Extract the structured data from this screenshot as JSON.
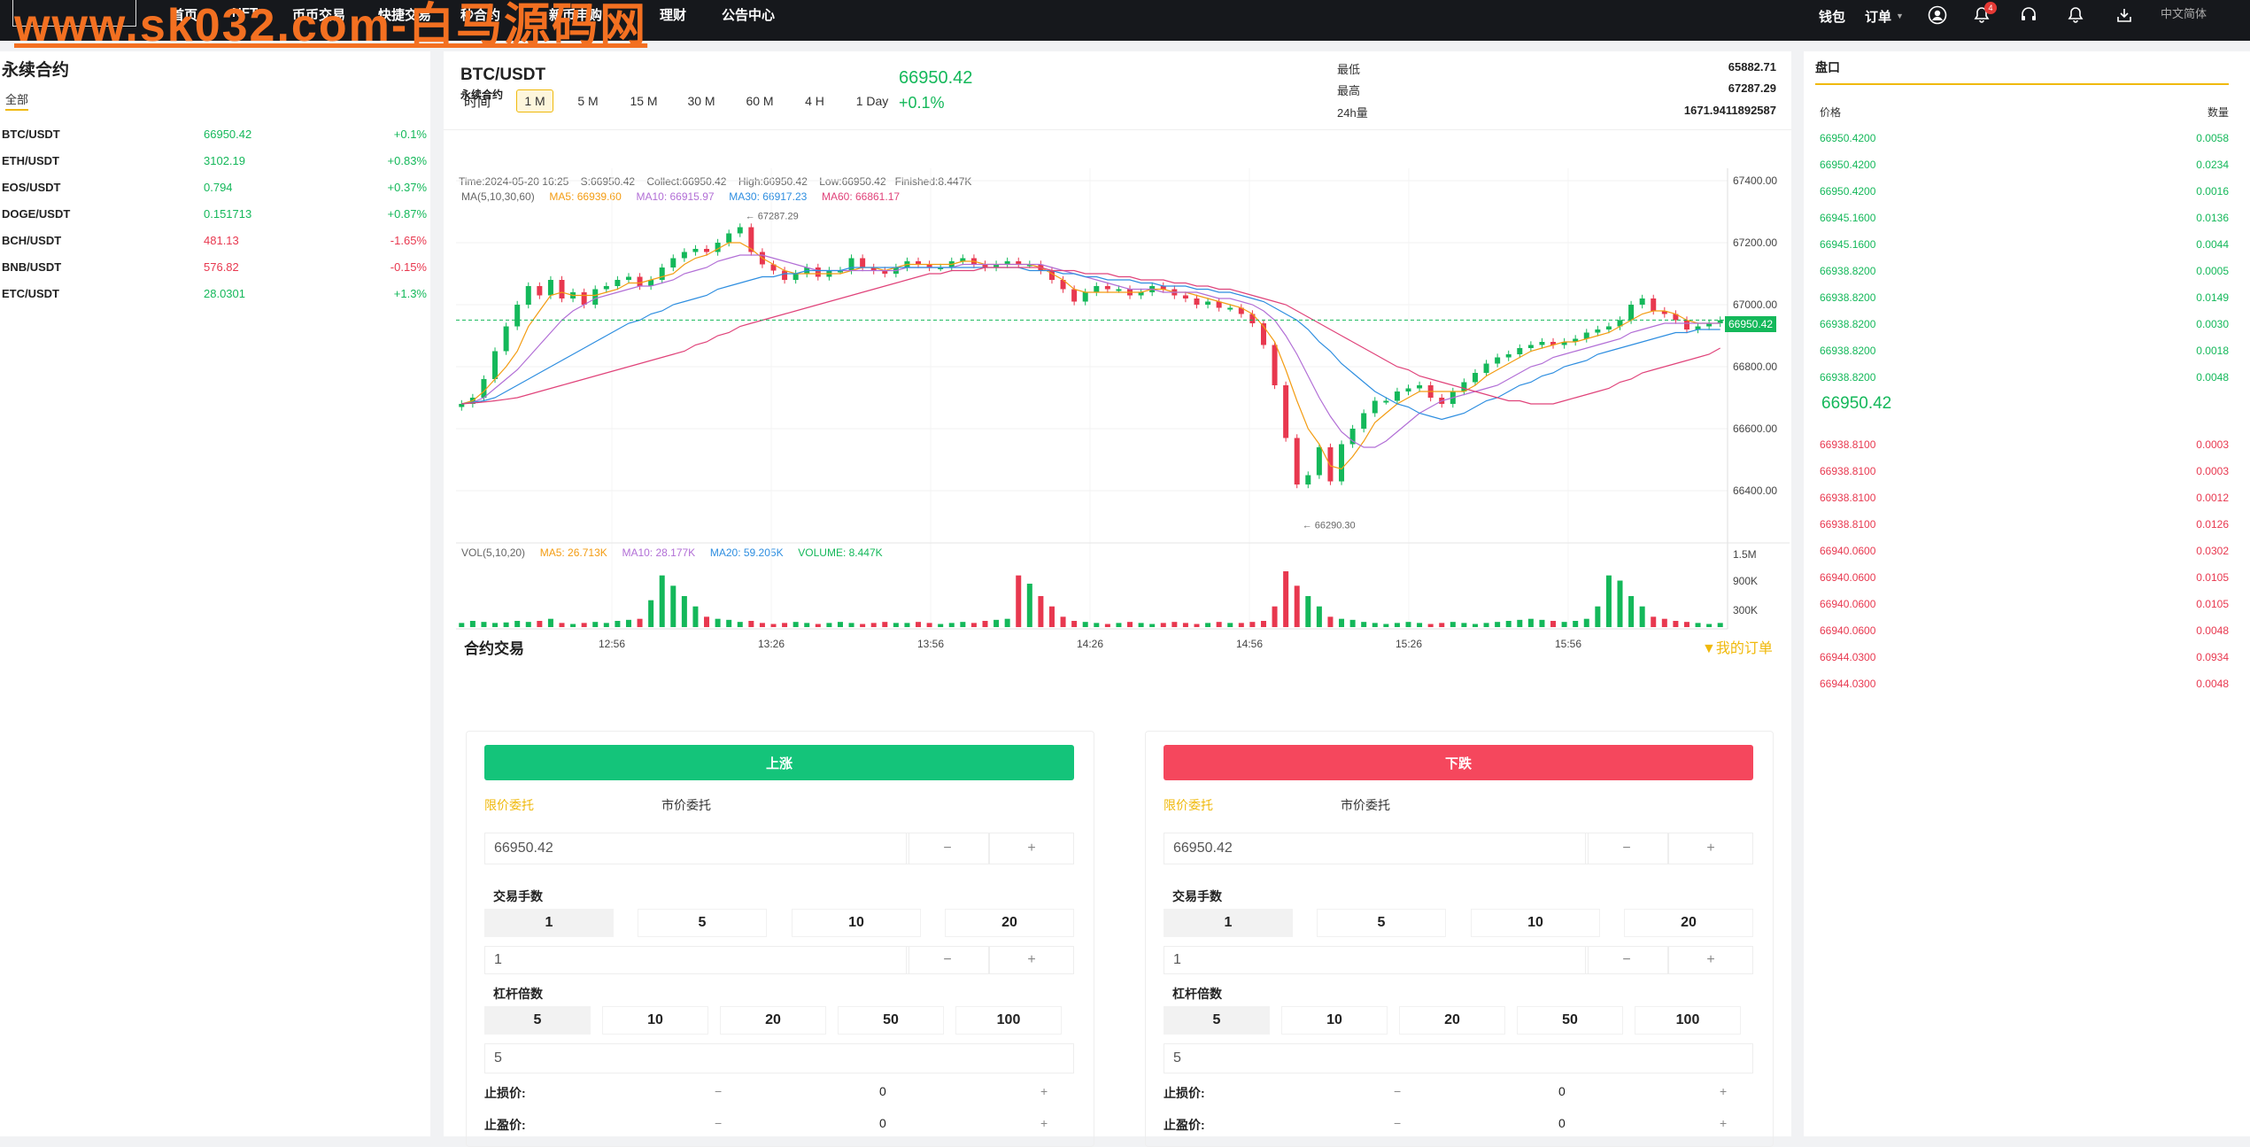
{
  "watermark": "www.sk032.com-白马源码网",
  "nav": [
    "首页",
    "NFT",
    "币币交易",
    "快捷交易",
    "秒合约",
    "新币申购",
    "理财",
    "公告中心"
  ],
  "top_right": {
    "wallet": "钱包",
    "orders": "订单",
    "notif_count": "4",
    "lang": "中文简体"
  },
  "left": {
    "title": "永续合约",
    "tab": "全部",
    "rows": [
      {
        "pair": "BTC/USDT",
        "price": "66950.42",
        "change": "+0.1%",
        "dir": "up"
      },
      {
        "pair": "ETH/USDT",
        "price": "3102.19",
        "change": "+0.83%",
        "dir": "up"
      },
      {
        "pair": "EOS/USDT",
        "price": "0.794",
        "change": "+0.37%",
        "dir": "up"
      },
      {
        "pair": "DOGE/USDT",
        "price": "0.151713",
        "change": "+0.87%",
        "dir": "up"
      },
      {
        "pair": "BCH/USDT",
        "price": "481.13",
        "change": "-1.65%",
        "dir": "dn"
      },
      {
        "pair": "BNB/USDT",
        "price": "576.82",
        "change": "-0.15%",
        "dir": "dn"
      },
      {
        "pair": "ETC/USDT",
        "price": "28.0301",
        "change": "+1.3%",
        "dir": "up"
      }
    ]
  },
  "header": {
    "pair": "BTC/USDT",
    "sub": "永续合约",
    "price": "66950.42",
    "change": "+0.1%",
    "low_label": "最低",
    "low": "65882.71",
    "high_label": "最高",
    "high": "67287.29",
    "vol_label": "24h量",
    "vol": "1671.9411892587"
  },
  "timeframes": [
    "时间",
    "1 M",
    "5 M",
    "15 M",
    "30 M",
    "60 M",
    "4 H",
    "1 Day"
  ],
  "chart_info": {
    "line1": [
      "Time:2024-05-20 16:25",
      "S:66950.42",
      "Collect:66950.42",
      "High:66950.42",
      "Low:66950.42",
      "Finished:8.447K"
    ],
    "ma_label": "MA(5,10,30,60)",
    "ma5": "MA5: 66939.60",
    "ma10": "MA10: 66915.97",
    "ma30": "MA30: 66917.23",
    "ma60": "MA60: 66861.17",
    "vol_label": "VOL(5,10,20)",
    "vma5": "MA5: 26.713K",
    "vma10": "MA10: 28.177K",
    "vma20": "MA20: 59.205K",
    "volume": "VOLUME: 8.447K",
    "hi_mark": "67287.29",
    "lo_mark": "66290.30",
    "current_tag": "66950.42"
  },
  "chart_data": {
    "type": "candlestick",
    "price_axis": [
      "67400.00",
      "67200.00",
      "67000.00",
      "66800.00",
      "66600.00",
      "66400.00"
    ],
    "volume_axis": [
      "1.5M",
      "900K",
      "300K"
    ],
    "time_axis": [
      "12:56",
      "13:26",
      "13:56",
      "14:26",
      "14:56",
      "15:26",
      "15:56"
    ],
    "ylim": [
      66240,
      67440
    ],
    "close": [
      66680,
      66700,
      66760,
      66850,
      66930,
      67000,
      67060,
      67030,
      67080,
      67020,
      67040,
      67000,
      67050,
      67060,
      67080,
      67090,
      67060,
      67080,
      67120,
      67150,
      67170,
      67180,
      67170,
      67200,
      67230,
      67250,
      67170,
      67130,
      67110,
      67080,
      67100,
      67120,
      67090,
      67110,
      67110,
      67150,
      67120,
      67110,
      67100,
      67120,
      67140,
      67130,
      67120,
      67120,
      67140,
      67150,
      67130,
      67120,
      67130,
      67140,
      67130,
      67130,
      67110,
      67080,
      67050,
      67010,
      67040,
      67060,
      67050,
      67050,
      67030,
      67040,
      67060,
      67050,
      67030,
      67020,
      67000,
      67010,
      66990,
      66990,
      66970,
      66940,
      66870,
      66740,
      66570,
      66420,
      66450,
      66540,
      66430,
      66550,
      66600,
      66650,
      66690,
      66690,
      66720,
      66730,
      66740,
      66700,
      66680,
      66720,
      66750,
      66780,
      66810,
      66830,
      66840,
      66860,
      66870,
      66880,
      66870,
      66880,
      66890,
      66910,
      66920,
      66930,
      66950,
      67000,
      67020,
      66980,
      66970,
      66950,
      66920,
      66930,
      66940,
      66950
    ],
    "volume_k": [
      40,
      60,
      50,
      40,
      45,
      60,
      50,
      60,
      80,
      40,
      30,
      40,
      50,
      40,
      60,
      70,
      80,
      260,
      500,
      400,
      300,
      200,
      100,
      80,
      70,
      50,
      60,
      40,
      30,
      40,
      50,
      40,
      30,
      40,
      50,
      40,
      30,
      40,
      50,
      40,
      40,
      50,
      40,
      30,
      40,
      50,
      40,
      60,
      70,
      80,
      500,
      420,
      300,
      200,
      100,
      60,
      50,
      40,
      30,
      40,
      50,
      40,
      30,
      40,
      50,
      40,
      30,
      40,
      50,
      40,
      40,
      50,
      60,
      200,
      540,
      400,
      300,
      200,
      100,
      80,
      70,
      50,
      40,
      30,
      40,
      50,
      40,
      30,
      40,
      50,
      40,
      30,
      40,
      50,
      60,
      70,
      80,
      70,
      60,
      50,
      60,
      80,
      200,
      500,
      450,
      300,
      200,
      100,
      80,
      60,
      50,
      40,
      30,
      40,
      30
    ],
    "ma5": [
      66680,
      66690,
      66720,
      66760,
      66800,
      66850,
      66930,
      66980,
      67030,
      67040,
      67030,
      67030,
      67030,
      67040,
      67050,
      67070,
      67070,
      67080,
      67090,
      67100,
      67130,
      67150,
      67160,
      67180,
      67200,
      67200,
      67180,
      67150,
      67130,
      67110,
      67100,
      67100,
      67100,
      67100,
      67100,
      67110,
      67120,
      67120,
      67110,
      67120,
      67130,
      67130,
      67130,
      67130,
      67130,
      67140,
      67140,
      67130,
      67130,
      67130,
      67130,
      67130,
      67120,
      67100,
      67080,
      67050,
      67040,
      67040,
      67040,
      67040,
      67040,
      67040,
      67050,
      67050,
      67040,
      67040,
      67030,
      67020,
      67010,
      67000,
      66990,
      66970,
      66930,
      66880,
      66790,
      66690,
      66600,
      66550,
      66480,
      66470,
      66510,
      66560,
      66620,
      66650,
      66680,
      66700,
      66720,
      66720,
      66720,
      66720,
      66720,
      66740,
      66770,
      66790,
      66810,
      66830,
      66850,
      66860,
      66870,
      66880,
      66880,
      66890,
      66900,
      66910,
      66930,
      66950,
      66970,
      66980,
      66980,
      66970,
      66950,
      66940,
      66940,
      66940
    ],
    "ma10": [
      66680,
      66685,
      66700,
      66730,
      66760,
      66790,
      66830,
      66870,
      66910,
      66950,
      66980,
      67000,
      67020,
      67030,
      67040,
      67050,
      67060,
      67060,
      67070,
      67080,
      67100,
      67110,
      67120,
      67140,
      67150,
      67160,
      67160,
      67160,
      67150,
      67140,
      67130,
      67120,
      67110,
      67110,
      67110,
      67110,
      67110,
      67110,
      67110,
      67110,
      67120,
      67120,
      67120,
      67120,
      67120,
      67130,
      67130,
      67130,
      67130,
      67130,
      67130,
      67130,
      67130,
      67120,
      67110,
      67100,
      67090,
      67080,
      67070,
      67060,
      67050,
      67050,
      67050,
      67040,
      67040,
      67040,
      67040,
      67030,
      67020,
      67020,
      67010,
      67000,
      66980,
      66950,
      66900,
      66840,
      66770,
      66700,
      66640,
      66590,
      66560,
      66540,
      66540,
      66560,
      66590,
      66620,
      66650,
      66670,
      66690,
      66700,
      66710,
      66720,
      66730,
      66740,
      66760,
      66780,
      66800,
      66810,
      66830,
      66840,
      66850,
      66860,
      66870,
      66880,
      66890,
      66910,
      66920,
      66930,
      66940,
      66940,
      66940,
      66940,
      66940,
      66940
    ],
    "ma30": [
      66680,
      66685,
      66690,
      66700,
      66720,
      66740,
      66760,
      66780,
      66800,
      66820,
      66840,
      66860,
      66880,
      66900,
      66920,
      66940,
      66950,
      66970,
      66980,
      67000,
      67010,
      67020,
      67030,
      67050,
      67060,
      67070,
      67080,
      67090,
      67090,
      67100,
      67100,
      67110,
      67110,
      67110,
      67110,
      67120,
      67120,
      67120,
      67120,
      67120,
      67120,
      67120,
      67120,
      67120,
      67120,
      67120,
      67120,
      67120,
      67120,
      67120,
      67120,
      67110,
      67110,
      67110,
      67100,
      67100,
      67090,
      67090,
      67080,
      67080,
      67080,
      67070,
      67070,
      67060,
      67060,
      67060,
      67050,
      67050,
      67040,
      67040,
      67030,
      67020,
      67010,
      66990,
      66970,
      66950,
      66920,
      66880,
      66850,
      66810,
      66780,
      66750,
      66720,
      66700,
      66680,
      66670,
      66650,
      66640,
      66630,
      66640,
      66650,
      66670,
      66690,
      66700,
      66720,
      66740,
      66750,
      66770,
      66780,
      66800,
      66810,
      66820,
      66840,
      66850,
      66860,
      66870,
      66880,
      66890,
      66900,
      66910,
      66910,
      66920,
      66920,
      66920
    ],
    "ma60": [
      66680,
      66683,
      66686,
      66690,
      66695,
      66700,
      66710,
      66720,
      66730,
      66740,
      66750,
      66760,
      66770,
      66780,
      66790,
      66800,
      66810,
      66820,
      66830,
      66840,
      66850,
      66870,
      66880,
      66900,
      66910,
      66930,
      66940,
      66950,
      66960,
      66970,
      66980,
      66990,
      67000,
      67010,
      67020,
      67030,
      67040,
      67050,
      67060,
      67070,
      67080,
      67090,
      67100,
      67100,
      67110,
      67110,
      67110,
      67120,
      67120,
      67120,
      67120,
      67120,
      67120,
      67110,
      67110,
      67110,
      67100,
      67100,
      67100,
      67090,
      67090,
      67080,
      67080,
      67080,
      67070,
      67070,
      67060,
      67060,
      67050,
      67050,
      67040,
      67030,
      67020,
      67010,
      67000,
      66980,
      66960,
      66940,
      66920,
      66900,
      66880,
      66860,
      66840,
      66820,
      66800,
      66790,
      66770,
      66760,
      66750,
      66740,
      66730,
      66720,
      66710,
      66700,
      66690,
      66690,
      66680,
      66680,
      66680,
      66690,
      66700,
      66710,
      66720,
      66730,
      66750,
      66760,
      66780,
      66790,
      66800,
      66810,
      66820,
      66830,
      66840,
      66860
    ]
  },
  "trade": {
    "title": "合约交易",
    "my_orders": "我的订单",
    "buy": "上涨",
    "sell": "下跌",
    "tab_limit": "限价委托",
    "tab_market": "市价委托",
    "price_val": "66950.42",
    "minus": "−",
    "plus": "+",
    "lots_label": "交易手数",
    "lots": [
      "1",
      "5",
      "10",
      "20"
    ],
    "lots_val": "1",
    "lev_label": "杠杆倍数",
    "lev": [
      "5",
      "10",
      "20",
      "50",
      "100"
    ],
    "lev_val": "5",
    "sl_label": "止损价:",
    "tp_label": "止盈价:",
    "sl_val": "0",
    "tp_val": "0"
  },
  "orderbook": {
    "title": "盘口",
    "h_price": "价格",
    "h_qty": "数量",
    "mid": "66950.42",
    "bids": [
      [
        "66950.4200",
        "0.0058"
      ],
      [
        "66950.4200",
        "0.0234"
      ],
      [
        "66950.4200",
        "0.0016"
      ],
      [
        "66945.1600",
        "0.0136"
      ],
      [
        "66945.1600",
        "0.0044"
      ],
      [
        "66938.8200",
        "0.0005"
      ],
      [
        "66938.8200",
        "0.0149"
      ],
      [
        "66938.8200",
        "0.0030"
      ],
      [
        "66938.8200",
        "0.0018"
      ],
      [
        "66938.8200",
        "0.0048"
      ]
    ],
    "asks": [
      [
        "66938.8100",
        "0.0003"
      ],
      [
        "66938.8100",
        "0.0003"
      ],
      [
        "66938.8100",
        "0.0012"
      ],
      [
        "66938.8100",
        "0.0126"
      ],
      [
        "66940.0600",
        "0.0302"
      ],
      [
        "66940.0600",
        "0.0105"
      ],
      [
        "66940.0600",
        "0.0105"
      ],
      [
        "66940.0600",
        "0.0048"
      ],
      [
        "66944.0300",
        "0.0934"
      ],
      [
        "66944.0300",
        "0.0048"
      ]
    ]
  }
}
